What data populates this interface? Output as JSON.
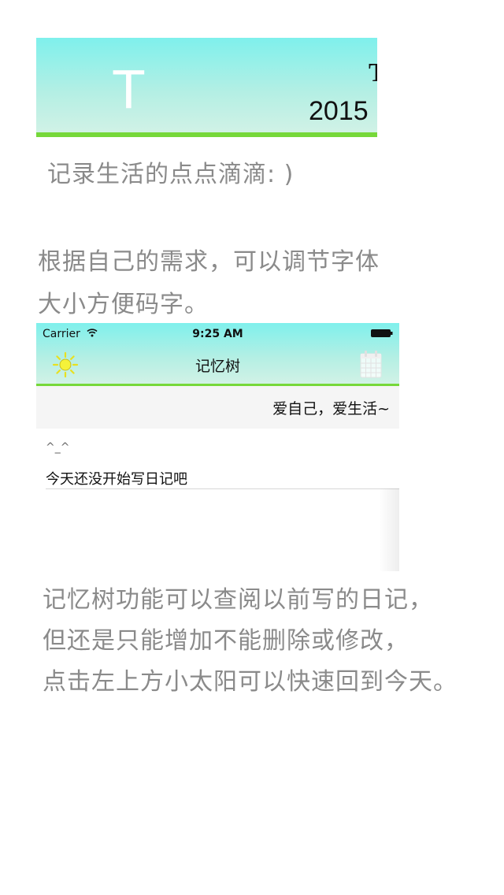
{
  "banner": {
    "letter": "T",
    "top_char": "T",
    "date_text": "2015",
    "colors": {
      "gradient_top": "#7ff0ec",
      "gradient_bottom": "#d4f2e6",
      "accent_bar": "#76d83a"
    }
  },
  "captions": {
    "first": "记录生活的点点滴滴: )",
    "second": {
      "line1": "根据自己的需求，可以调节字体",
      "line2": "大小方便码字。"
    },
    "third": {
      "line1": "记忆树功能可以查阅以前写的日记，",
      "line2": "但还是只能增加不能删除或修改，",
      "line3": "点击左上方小太阳可以快速回到今天。"
    }
  },
  "phone": {
    "status_bar": {
      "carrier": "Carrier",
      "time": "9:25 AM",
      "wifi_icon": "wifi-icon",
      "battery_icon": "battery-icon"
    },
    "nav": {
      "title": "记忆树",
      "left_icon": "sun-icon",
      "right_icon": "calendar-icon"
    },
    "motto": "爱自己，爱生活~",
    "emoticon": "^_^",
    "entry_placeholder": "今天还没开始写日记吧"
  }
}
